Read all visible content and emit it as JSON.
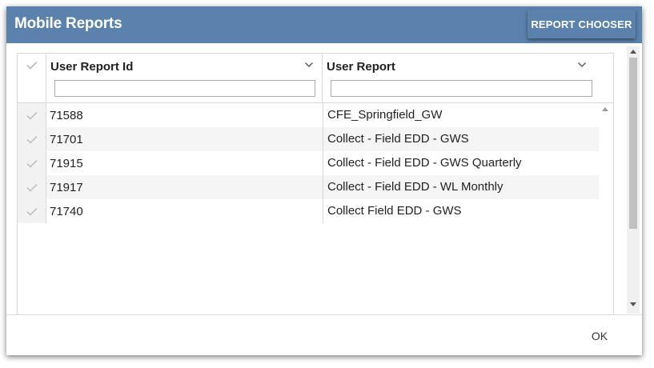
{
  "dialog": {
    "title": "Mobile Reports",
    "report_chooser_label": "REPORT CHOOSER",
    "ok_label": "OK"
  },
  "grid": {
    "columns": [
      {
        "label": "User Report Id",
        "icon": "chevron-down-icon",
        "filter_value": ""
      },
      {
        "label": "User Report",
        "icon": "chevron-down-icon",
        "filter_value": ""
      }
    ],
    "select_icon": "checkmark-icon",
    "rows": [
      {
        "id": "71588",
        "report": "CFE_Springfield_GW"
      },
      {
        "id": "71701",
        "report": "Collect - Field EDD - GWS"
      },
      {
        "id": "71915",
        "report": "Collect - Field EDD - GWS Quarterly"
      },
      {
        "id": "71917",
        "report": "Collect - Field EDD - WL Monthly"
      },
      {
        "id": "71740",
        "report": "Collect Field EDD - GWS"
      }
    ]
  },
  "colors": {
    "titlebar": "#5b82ad",
    "title_text": "#ffffff",
    "alt_row": "#f5f5f5"
  }
}
